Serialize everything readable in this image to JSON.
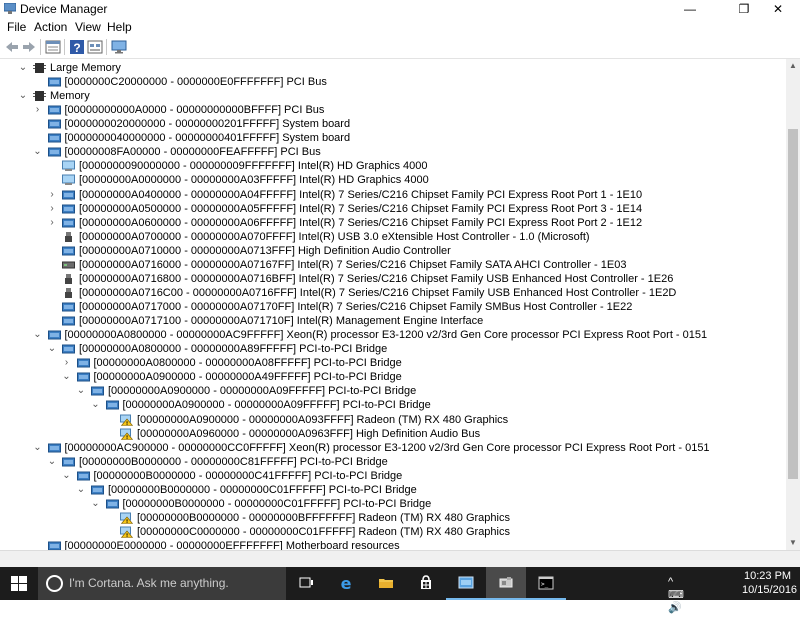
{
  "window": {
    "title": "Device Manager",
    "minimize_glyph": "—",
    "maximize_glyph": "❐",
    "close_glyph": "✕"
  },
  "menu": [
    "File",
    "Action",
    "View",
    "Help"
  ],
  "toolbar": {
    "icons": [
      "back-arrow-icon",
      "forward-arrow-icon",
      "properties-icon",
      "help-icon",
      "view-icon",
      "monitor-icon"
    ]
  },
  "tree": [
    {
      "exp": "open",
      "level": 1,
      "icon": "memory",
      "text": "Large Memory"
    },
    {
      "exp": "none",
      "level": 2,
      "icon": "folder",
      "text": "[0000000C20000000 - 0000000E0FFFFFFF]  PCI Bus"
    },
    {
      "exp": "open",
      "level": 1,
      "icon": "memory",
      "text": "Memory"
    },
    {
      "exp": "closed",
      "level": 2,
      "icon": "folder",
      "text": "[00000000000A0000 - 00000000000BFFFF]  PCI Bus"
    },
    {
      "exp": "none",
      "level": 2,
      "icon": "folder",
      "text": "[0000000020000000 - 00000000201FFFFF]  System board"
    },
    {
      "exp": "none",
      "level": 2,
      "icon": "folder",
      "text": "[0000000040000000 - 00000000401FFFFF]  System board"
    },
    {
      "exp": "open",
      "level": 2,
      "icon": "folder",
      "text": "[00000008FA00000 - 00000000FEAFFFFF]  PCI Bus"
    },
    {
      "exp": "none",
      "level": 3,
      "icon": "display",
      "text": "[0000000090000000 - 000000009FFFFFFF]  Intel(R) HD Graphics 4000"
    },
    {
      "exp": "none",
      "level": 3,
      "icon": "display",
      "text": "[00000000A0000000 - 00000000A03FFFFF]  Intel(R) HD Graphics 4000"
    },
    {
      "exp": "closed",
      "level": 3,
      "icon": "folder",
      "text": "[00000000A0400000 - 00000000A04FFFFF]  Intel(R) 7 Series/C216 Chipset Family PCI Express Root Port 1 - 1E10"
    },
    {
      "exp": "closed",
      "level": 3,
      "icon": "folder",
      "text": "[00000000A0500000 - 00000000A05FFFFF]  Intel(R) 7 Series/C216 Chipset Family PCI Express Root Port 3 - 1E14"
    },
    {
      "exp": "closed",
      "level": 3,
      "icon": "folder",
      "text": "[00000000A0600000 - 00000000A06FFFFF]  Intel(R) 7 Series/C216 Chipset Family PCI Express Root Port 2 - 1E12"
    },
    {
      "exp": "none",
      "level": 3,
      "icon": "usb",
      "text": "[00000000A0700000 - 00000000A070FFFF]  Intel(R) USB 3.0 eXtensible Host Controller - 1.0 (Microsoft)"
    },
    {
      "exp": "none",
      "level": 3,
      "icon": "folder",
      "text": "[00000000A0710000 - 00000000A0713FFF]  High Definition Audio Controller"
    },
    {
      "exp": "none",
      "level": 3,
      "icon": "disk",
      "text": "[00000000A0716000 - 00000000A07167FF]  Intel(R) 7 Series/C216 Chipset Family SATA AHCI Controller - 1E03"
    },
    {
      "exp": "none",
      "level": 3,
      "icon": "usb",
      "text": "[00000000A0716800 - 00000000A0716BFF]  Intel(R) 7 Series/C216 Chipset Family USB Enhanced Host Controller - 1E26"
    },
    {
      "exp": "none",
      "level": 3,
      "icon": "usb",
      "text": "[00000000A0716C00 - 00000000A0716FFF]  Intel(R) 7 Series/C216 Chipset Family USB Enhanced Host Controller - 1E2D"
    },
    {
      "exp": "none",
      "level": 3,
      "icon": "folder",
      "text": "[00000000A0717000 - 00000000A07170FF]  Intel(R) 7 Series/C216 Chipset Family SMBus Host Controller - 1E22"
    },
    {
      "exp": "none",
      "level": 3,
      "icon": "folder",
      "text": "[00000000A0717100 - 00000000A071710F]  Intel(R) Management Engine Interface"
    },
    {
      "exp": "open",
      "level": 2,
      "icon": "folder",
      "text": "[00000000A0800000 - 00000000AC9FFFFF]  Xeon(R) processor E3-1200 v2/3rd Gen Core processor PCI Express Root Port - 0151"
    },
    {
      "exp": "open",
      "level": 3,
      "icon": "folder",
      "text": "[00000000A0800000 - 00000000A89FFFFF]  PCI-to-PCI Bridge"
    },
    {
      "exp": "closed",
      "level": 4,
      "icon": "folder",
      "text": "[00000000A0800000 - 00000000A08FFFFF]  PCI-to-PCI Bridge"
    },
    {
      "exp": "open",
      "level": 4,
      "icon": "folder",
      "text": "[00000000A0900000 - 00000000A49FFFFF]  PCI-to-PCI Bridge"
    },
    {
      "exp": "open",
      "level": 5,
      "icon": "folder",
      "text": "[00000000A0900000 - 00000000A09FFFFF]  PCI-to-PCI Bridge"
    },
    {
      "exp": "open",
      "level": 6,
      "icon": "folder",
      "text": "[00000000A0900000 - 00000000A09FFFFF]  PCI-to-PCI Bridge"
    },
    {
      "exp": "none",
      "level": 7,
      "icon": "warn",
      "text": "[00000000A0900000 - 00000000A093FFFF]  Radeon (TM) RX 480 Graphics"
    },
    {
      "exp": "none",
      "level": 7,
      "icon": "warn",
      "text": "[00000000A0960000 - 00000000A0963FFF]  High Definition Audio Bus"
    },
    {
      "exp": "open",
      "level": 2,
      "icon": "folder",
      "text": "[00000000AC900000 - 00000000CC0FFFFF]  Xeon(R) processor E3-1200 v2/3rd Gen Core processor PCI Express Root Port - 0151"
    },
    {
      "exp": "open",
      "level": 3,
      "icon": "folder",
      "text": "[00000000B0000000 - 00000000C81FFFFF]  PCI-to-PCI Bridge"
    },
    {
      "exp": "open",
      "level": 4,
      "icon": "folder",
      "text": "[00000000B0000000 - 00000000C41FFFFF]  PCI-to-PCI Bridge"
    },
    {
      "exp": "open",
      "level": 5,
      "icon": "folder",
      "text": "[00000000B0000000 - 00000000C01FFFFF]  PCI-to-PCI Bridge"
    },
    {
      "exp": "open",
      "level": 6,
      "icon": "folder",
      "text": "[00000000B0000000 - 00000000C01FFFFF]  PCI-to-PCI Bridge"
    },
    {
      "exp": "none",
      "level": 7,
      "icon": "warn",
      "text": "[00000000B0000000 - 00000000BFFFFFFF]  Radeon (TM) RX 480 Graphics"
    },
    {
      "exp": "none",
      "level": 7,
      "icon": "warn",
      "text": "[00000000C0000000 - 00000000C01FFFFF]  Radeon (TM) RX 480 Graphics"
    },
    {
      "exp": "none",
      "level": 2,
      "icon": "folder",
      "text": "[00000000E0000000 - 00000000EFFFFFFF]  Motherboard resources"
    }
  ],
  "taskbar": {
    "search_placeholder": "I'm Cortana. Ask me anything.",
    "apps": [
      "task-view",
      "edge",
      "file-explorer",
      "store",
      "control-panel",
      "device-manager",
      "command-prompt"
    ],
    "time": "10:23 PM",
    "date": "10/15/2016",
    "tray_glyphs": "^  ⌨  🔊  ▭"
  },
  "colors": {
    "taskbar": "#1c1c1c",
    "accent": "#76b9ed",
    "folder": "#3c7fc4"
  }
}
